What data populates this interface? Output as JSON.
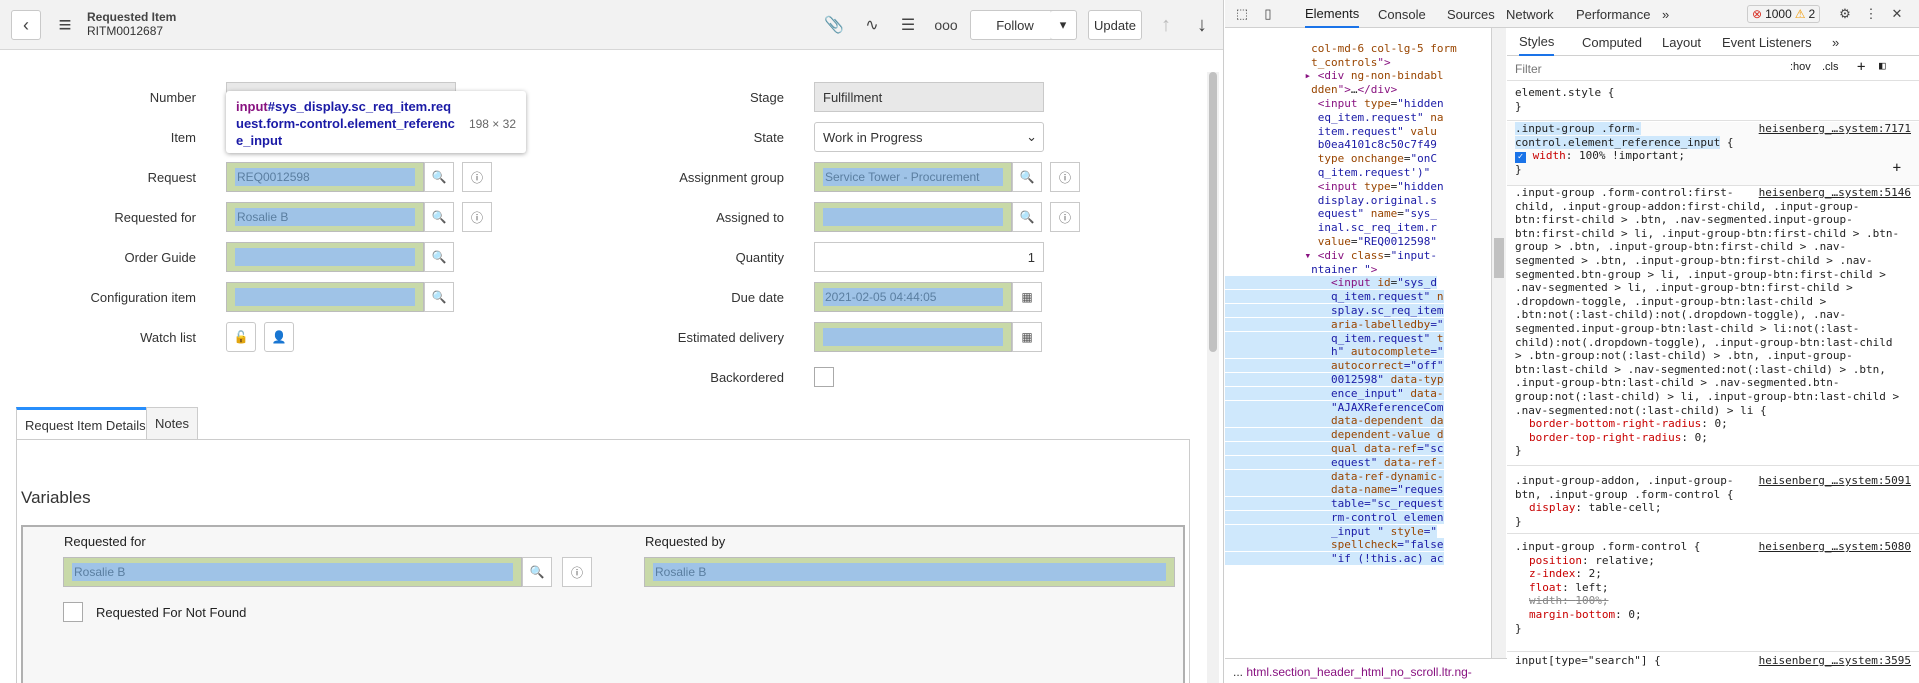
{
  "header": {
    "title": "Requested Item",
    "number": "RITM0012687",
    "follow": "Follow",
    "update": "Update"
  },
  "form": {
    "number_label": "Number",
    "item_label": "Item",
    "request_label": "Request",
    "request_value": "REQ0012598",
    "requested_for_label": "Requested for",
    "requested_for_value": "Rosalie B",
    "order_guide_label": "Order Guide",
    "config_item_label": "Configuration item",
    "watch_list_label": "Watch list",
    "stage_label": "Stage",
    "stage_value": "Fulfillment",
    "state_label": "State",
    "state_value": "Work in Progress",
    "assignment_group_label": "Assignment group",
    "assignment_group_value": "Service Tower - Procurement",
    "assigned_to_label": "Assigned to",
    "quantity_label": "Quantity",
    "quantity_value": "1",
    "due_date_label": "Due date",
    "due_date_value": "2021-02-05 04:44:05",
    "estimated_delivery_label": "Estimated delivery",
    "backordered_label": "Backordered"
  },
  "tooltip": {
    "tag": "input",
    "selector": "#sys_display.sc_req_item.request.form-control.element_reference_input",
    "size": "198 × 32"
  },
  "tabs": [
    "Request Item Details",
    "Notes"
  ],
  "variables": {
    "heading": "Variables",
    "requested_for_label": "Requested for",
    "requested_for_value": "Rosalie B",
    "requested_by_label": "Requested by",
    "requested_by_value": "Rosalie B",
    "not_found_label": "Requested For Not Found"
  },
  "devtools": {
    "tabs": [
      "Elements",
      "Console",
      "Sources",
      "Network",
      "Performance"
    ],
    "errors": "1000",
    "warnings": "2",
    "style_tabs": [
      "Styles",
      "Computed",
      "Layout",
      "Event Listeners"
    ],
    "filter_placeholder": "Filter",
    "hov": ":hov",
    ".cls": ".cls",
    "breadcrumb": "html.section_header_html_no_scroll.ltr.ng-"
  },
  "colors": {
    "accent": "#278efc",
    "highlight_field": "#9fc3e7",
    "highlight_pad": "#c8d9a8"
  }
}
